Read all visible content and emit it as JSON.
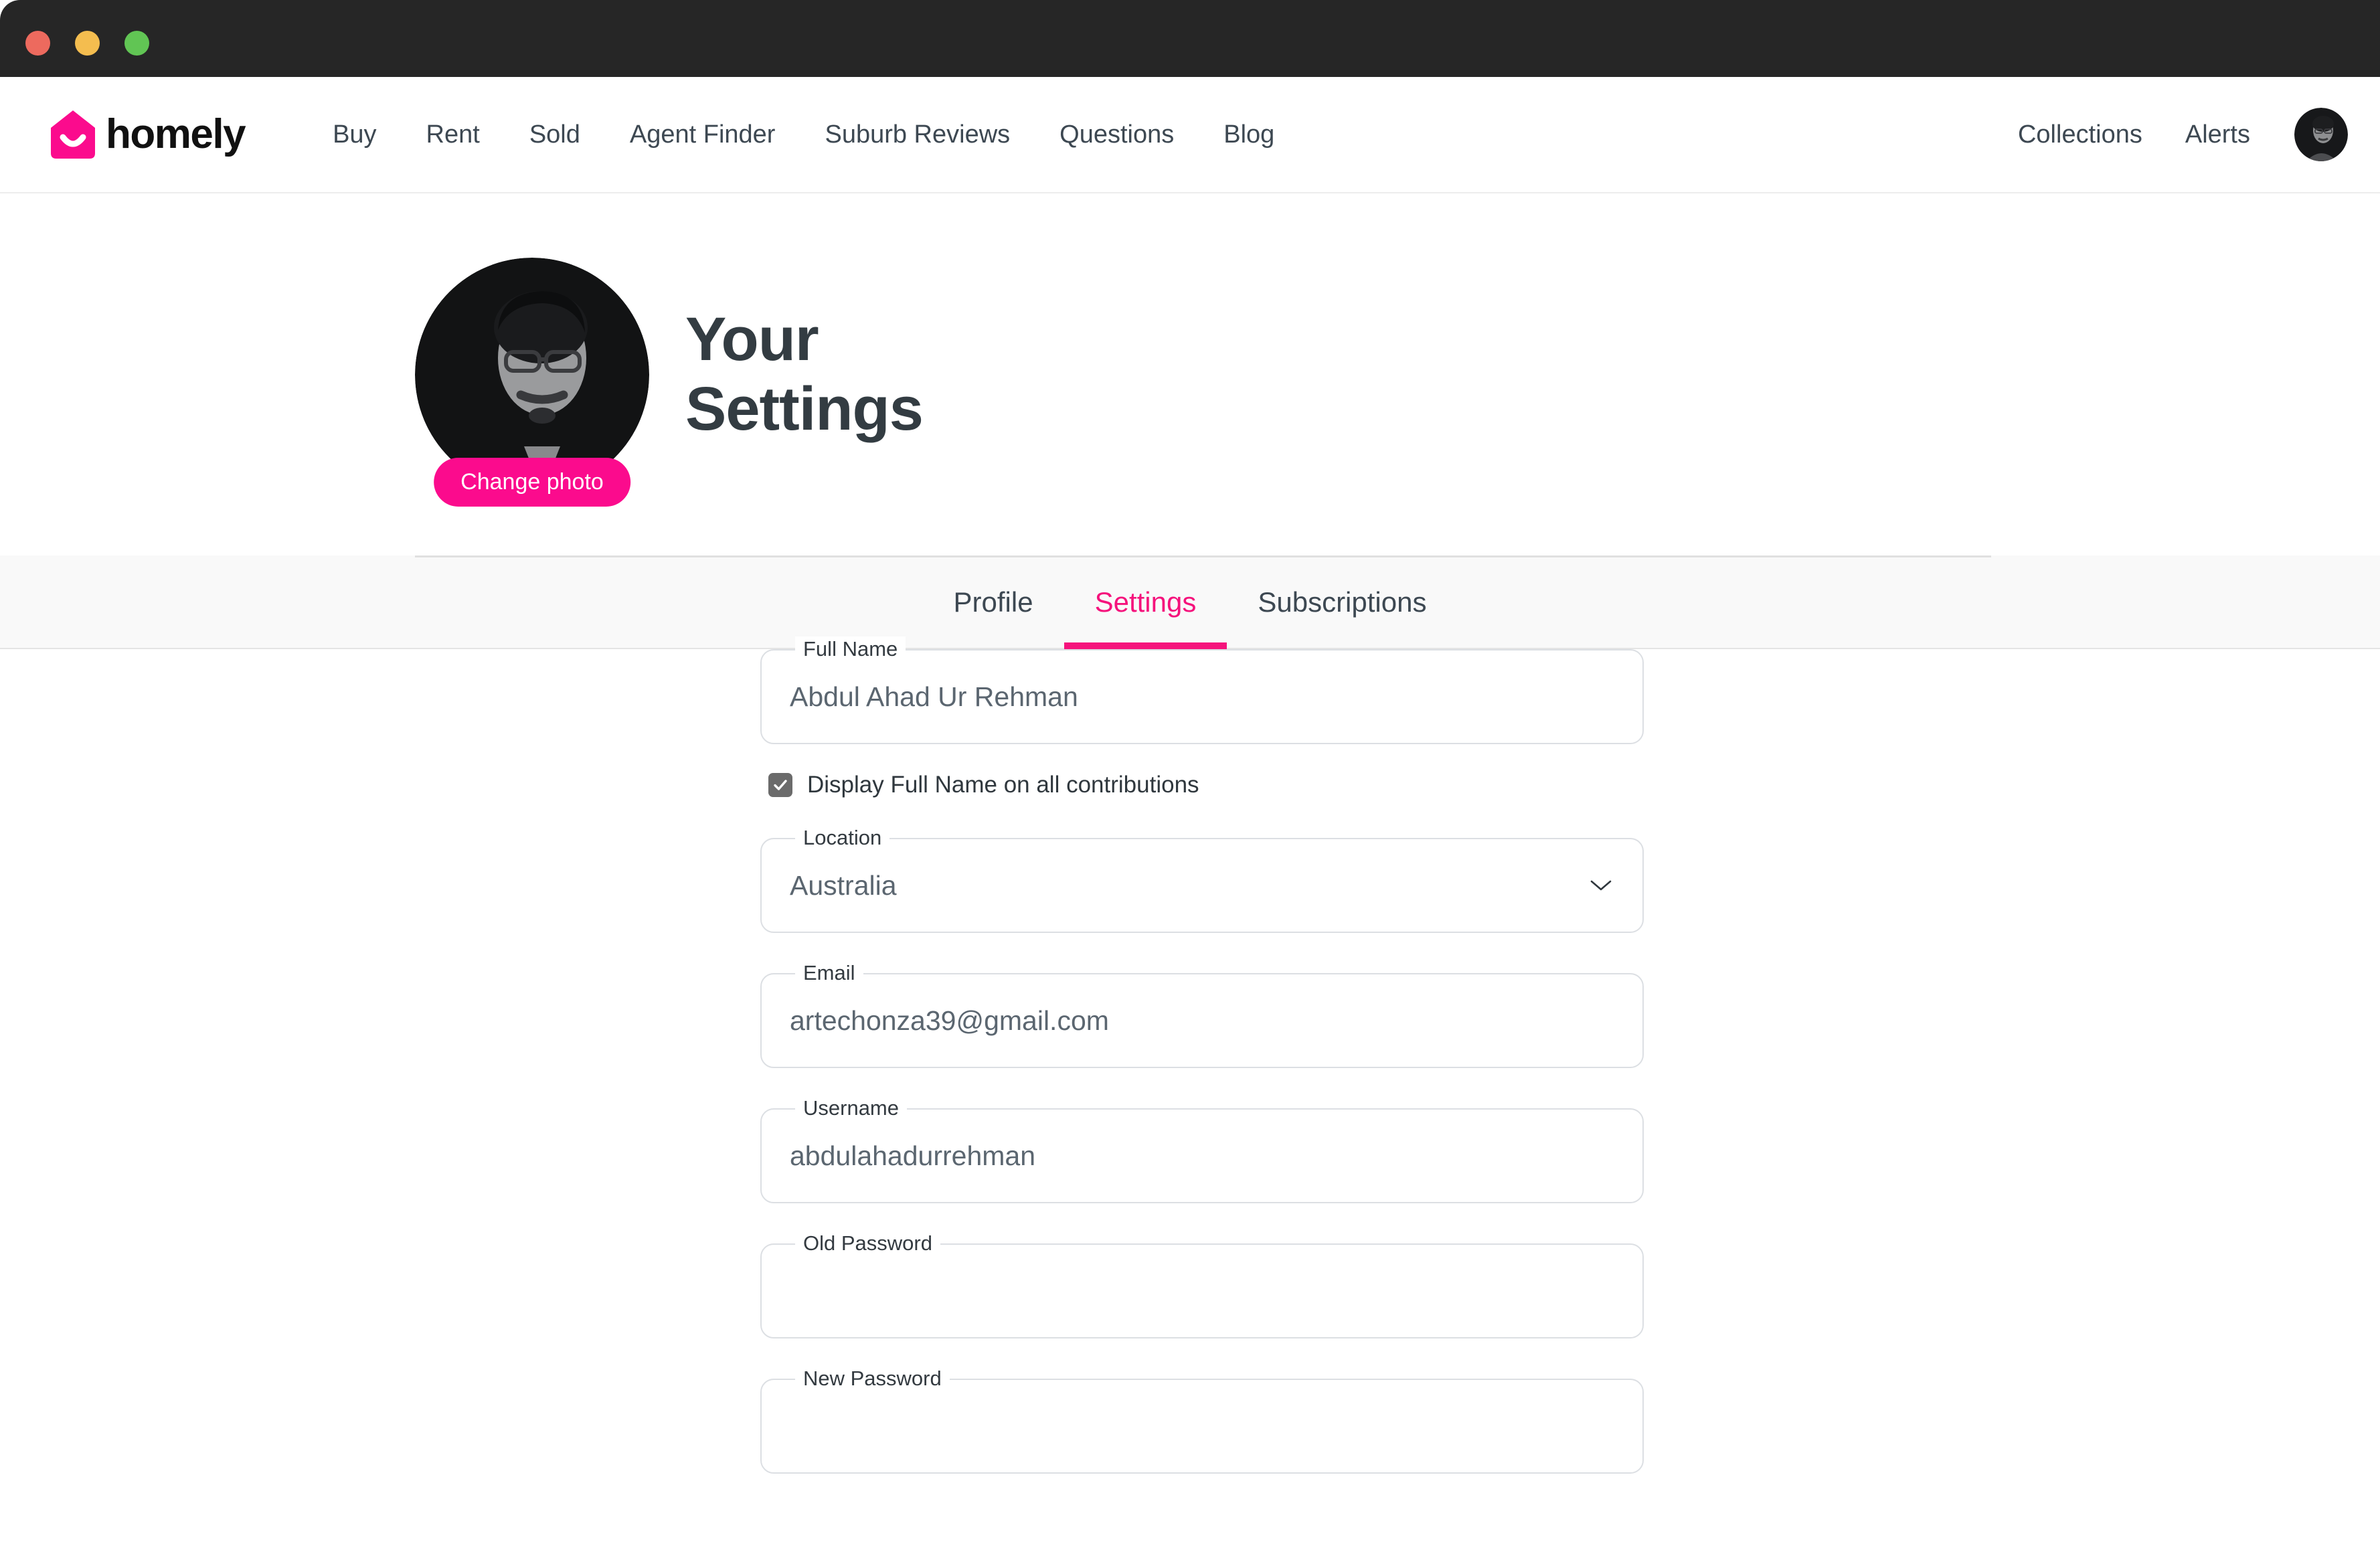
{
  "window": {
    "traffic_lights": [
      "close-button",
      "minimize-button",
      "maximize-button"
    ]
  },
  "header": {
    "brand": "homely",
    "nav_items": [
      {
        "label": "Buy"
      },
      {
        "label": "Rent"
      },
      {
        "label": "Sold"
      },
      {
        "label": "Agent Finder"
      },
      {
        "label": "Suburb Reviews"
      },
      {
        "label": "Questions"
      },
      {
        "label": "Blog"
      }
    ],
    "right_items": [
      {
        "label": "Collections"
      },
      {
        "label": "Alerts"
      }
    ],
    "avatar_name": "user-avatar"
  },
  "hero": {
    "title_line1": "Your",
    "title_line2": "Settings",
    "change_photo_label": "Change photo"
  },
  "tabs": [
    {
      "label": "Profile",
      "active": false
    },
    {
      "label": "Settings",
      "active": true
    },
    {
      "label": "Subscriptions",
      "active": false
    }
  ],
  "form": {
    "full_name": {
      "label": "Full Name",
      "value": "Abdul Ahad Ur Rehman",
      "placeholder": "Full Name"
    },
    "display_name_checkbox": {
      "label": "Display Full Name on all contributions",
      "checked": true
    },
    "location": {
      "label": "Location",
      "value": "Australia",
      "options": [
        "Australia"
      ]
    },
    "email": {
      "label": "Email",
      "value": "artechonza39@gmail.com",
      "placeholder": "Email"
    },
    "username": {
      "label": "Username",
      "value": "abdulahadurrehman",
      "placeholder": "Username"
    },
    "old_password": {
      "label": "Old Password",
      "value": "",
      "placeholder": ""
    },
    "new_password": {
      "label": "New Password",
      "value": "",
      "placeholder": ""
    }
  },
  "colors": {
    "accent_pink": "#FB0B8D",
    "tab_active_pink": "#F5127C",
    "titlebar": "#262626",
    "heading": "#333c42",
    "field_value": "#5b6670",
    "field_border": "#dcdfe3"
  }
}
